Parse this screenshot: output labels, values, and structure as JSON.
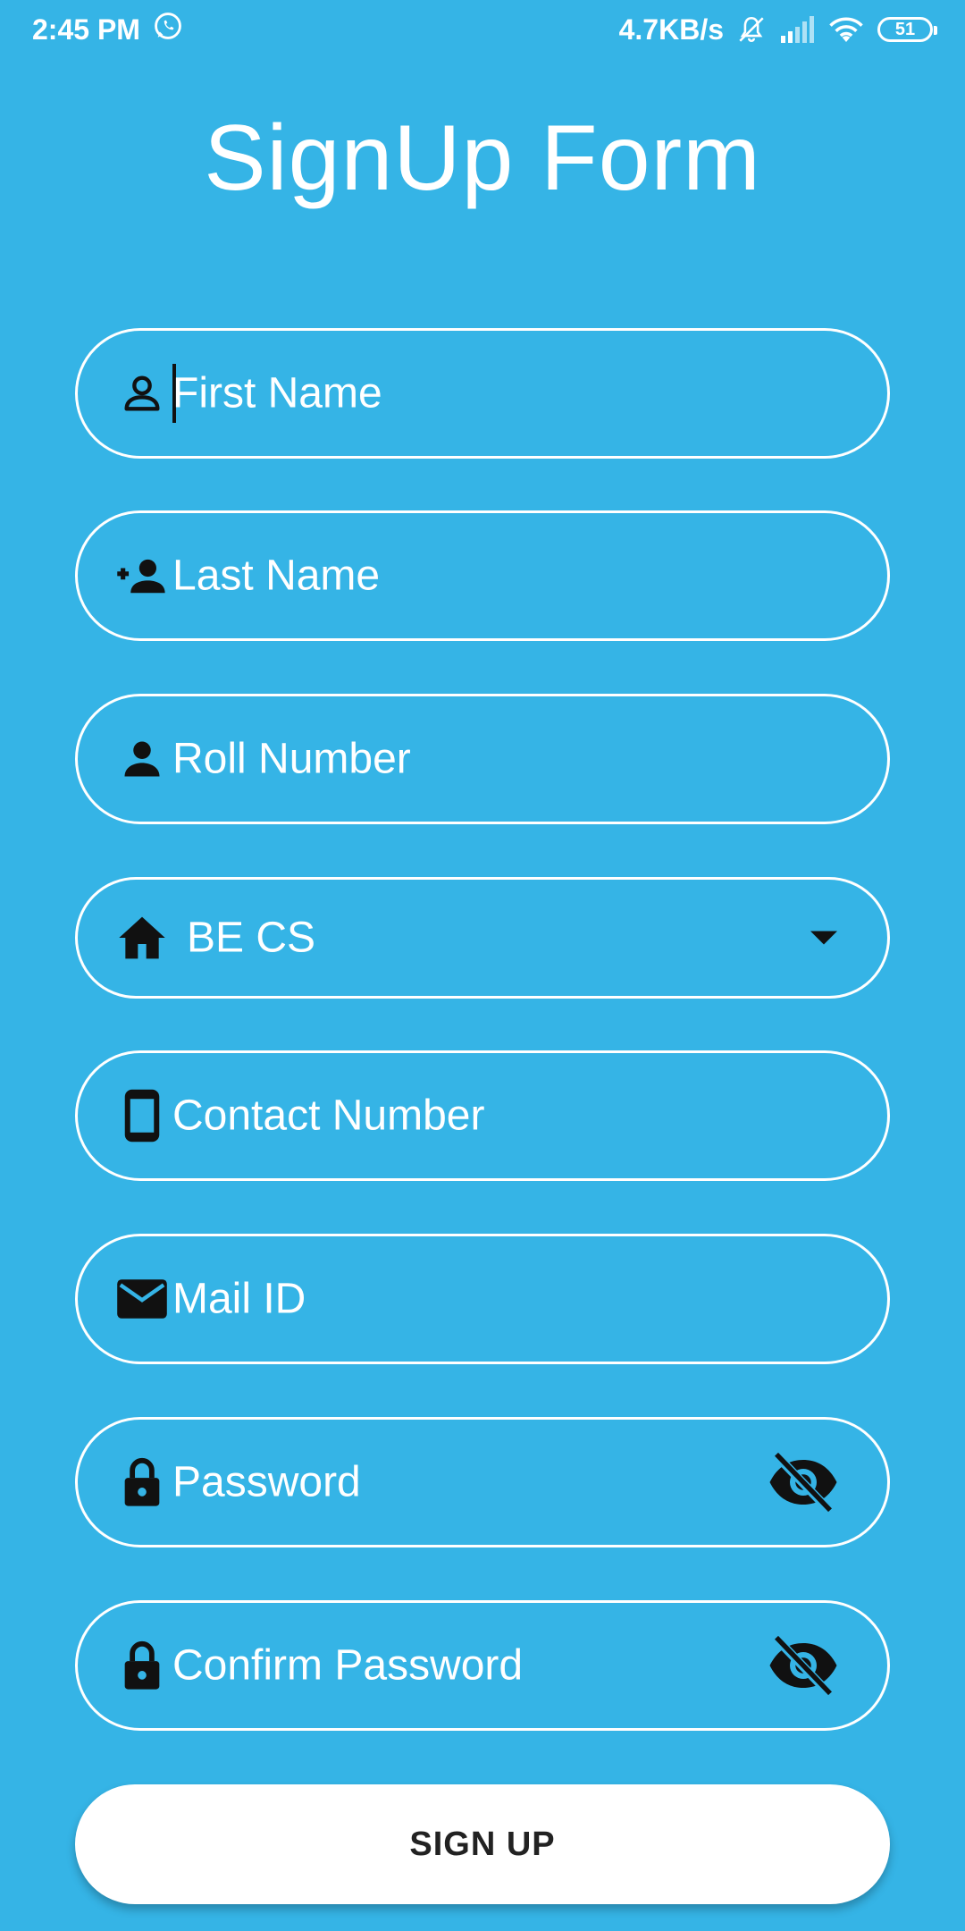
{
  "status_bar": {
    "time": "2:45 PM",
    "network_speed": "4.7KB/s",
    "battery": "51",
    "icons": [
      "whatsapp-icon",
      "notifications-off-icon",
      "signal-icon",
      "wifi-icon",
      "battery-icon"
    ]
  },
  "title": "SignUp Form",
  "fields": {
    "first_name": {
      "placeholder": "First Name",
      "icon": "person-outline-icon"
    },
    "last_name": {
      "placeholder": "Last Name",
      "icon": "person-add-icon"
    },
    "roll_number": {
      "placeholder": "Roll Number",
      "icon": "person-icon"
    },
    "department": {
      "selected": "BE CS",
      "icon": "home-icon"
    },
    "contact_number": {
      "placeholder": "Contact Number",
      "icon": "phone-icon"
    },
    "mail_id": {
      "placeholder": "Mail ID",
      "icon": "mail-icon"
    },
    "password": {
      "placeholder": "Password",
      "icon": "lock-icon",
      "toggle_icon": "visibility-off-icon"
    },
    "confirm_password": {
      "placeholder": "Confirm Password",
      "icon": "lock-icon",
      "toggle_icon": "visibility-off-icon"
    }
  },
  "signup_button": {
    "label": "SIGN UP"
  },
  "colors": {
    "background": "#35b4e6",
    "field_border": "#ffffff",
    "text": "#ffffff",
    "button_bg": "#ffffff",
    "button_text": "#222222",
    "icon": "#111111"
  }
}
